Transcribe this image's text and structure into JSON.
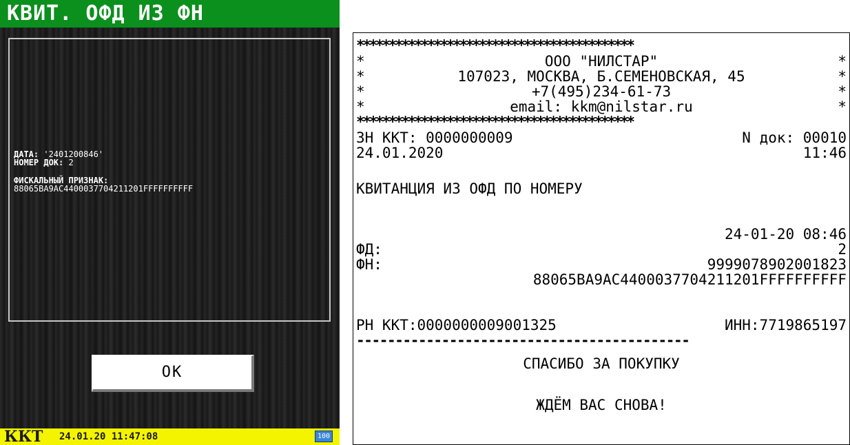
{
  "device": {
    "title": "КВИТ. ОФД ИЗ ФН",
    "info": {
      "date_label": "ДАТА:",
      "date_value": "'2401200846'",
      "doc_label": "НОМЕР ДОК:",
      "doc_value": "2",
      "fiscal_label": "ФИСКАЛЬНЫЙ ПРИЗНАК:",
      "fiscal_value": "88065BA9AC4400037704211201FFFFFFFFFF"
    },
    "ok_label": "OK",
    "status": {
      "device_name": "ККТ",
      "datetime": "24.01.20 11:47:08",
      "battery": "100"
    },
    "colors": {
      "title_bar": "#0b8f1d",
      "status_bar": "#f4f400",
      "battery": "#3b86d6"
    }
  },
  "receipt": {
    "stars": "*******************************************",
    "header_lines": [
      "ООО \"НИЛСТАР\"",
      "107023, МОСКВА, Б.СЕМЕНОВСКАЯ, 45",
      "+7(495)234-61-73",
      "email: kkm@nilstar.ru"
    ],
    "zn_label": "ЗН ККТ: 0000000009",
    "doc_no": "N док: 00010",
    "date": "24.01.2020",
    "time": "11:46",
    "title": "КВИТАНЦИЯ ИЗ ОФД ПО НОМЕРУ",
    "ofd_datetime": "24-01-20 08:46",
    "fd_label": "ФД:",
    "fd_value": "2",
    "fn_label": "ФН:",
    "fn_value": "9999078902001823",
    "fiscal_sign": "88065BA9AC4400037704211201FFFFFFFFFF",
    "rn": "РН ККТ:0000000009001325",
    "inn": "ИНН:7719865197",
    "dashes": "-------------------------------------------",
    "thanks": "СПАСИБО ЗА ПОКУПКУ",
    "come_again": "ЖДЁМ ВАС СНОВА!"
  }
}
